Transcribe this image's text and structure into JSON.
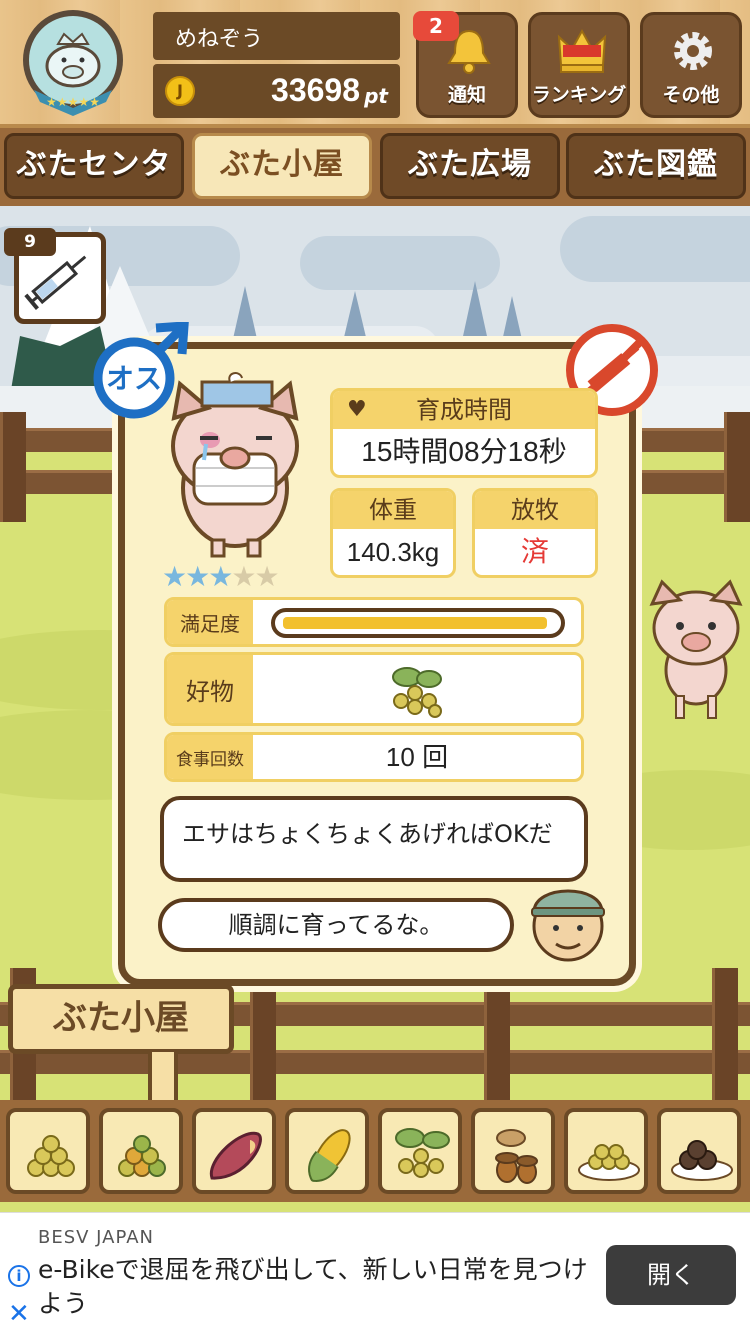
{
  "header": {
    "player_name": "めねぞう",
    "points": "33698",
    "points_unit": "pt",
    "coin_glyph": "J",
    "notifications": {
      "label": "通知",
      "count": "2",
      "icon": "bell-icon"
    },
    "ranking": {
      "label": "ランキング",
      "icon": "crown-icon"
    },
    "other": {
      "label": "その他",
      "icon": "gear-icon"
    }
  },
  "tabs": [
    {
      "label": "ぶたセンター",
      "active": false
    },
    {
      "label": "ぶた小屋",
      "active": true
    },
    {
      "label": "ぶた広場",
      "active": false
    },
    {
      "label": "ぶた図鑑",
      "active": false
    }
  ],
  "syringe": {
    "count": "9",
    "icon": "syringe-icon"
  },
  "pig_card": {
    "gender_label": "オス",
    "rating": {
      "filled": 3,
      "total": 5
    },
    "growth_time": {
      "label": "育成時間",
      "value": "15時間08分18秒"
    },
    "weight": {
      "label": "体重",
      "value": "140.3kg"
    },
    "grazing": {
      "label": "放牧",
      "value": "済"
    },
    "satisfaction": {
      "label": "満足度",
      "level": 0.98
    },
    "favorite": {
      "label": "好物",
      "icon": "soybean-icon"
    },
    "meals": {
      "label": "食事回数",
      "value": "10 回"
    },
    "tip_bubble": "エサはちょくちょくあげればOKだ",
    "comment_bubble": "順調に育ってるな。"
  },
  "sign_label": "ぶた小屋",
  "food_items": [
    "soybean-pile-icon",
    "mixed-beans-icon",
    "sweet-potato-icon",
    "corn-icon",
    "soybean-plant-icon",
    "acorn-icon",
    "beans-plate-icon",
    "dark-balls-plate-icon"
  ],
  "ad": {
    "brand": "BESV JAPAN",
    "text": "e-Bikeで退屈を飛び出して、新しい日常を見つけよう",
    "button": "開く",
    "info_glyph": "i",
    "close_glyph": "✕"
  },
  "colors": {
    "wood_dark": "#6b4a26",
    "card_bg": "#fbf2c8",
    "label_yellow": "#f5d36b",
    "male_blue": "#1e6fc4",
    "no_red": "#d9482c",
    "grazing_red": "#e53935",
    "star_blue": "#79b7de"
  }
}
